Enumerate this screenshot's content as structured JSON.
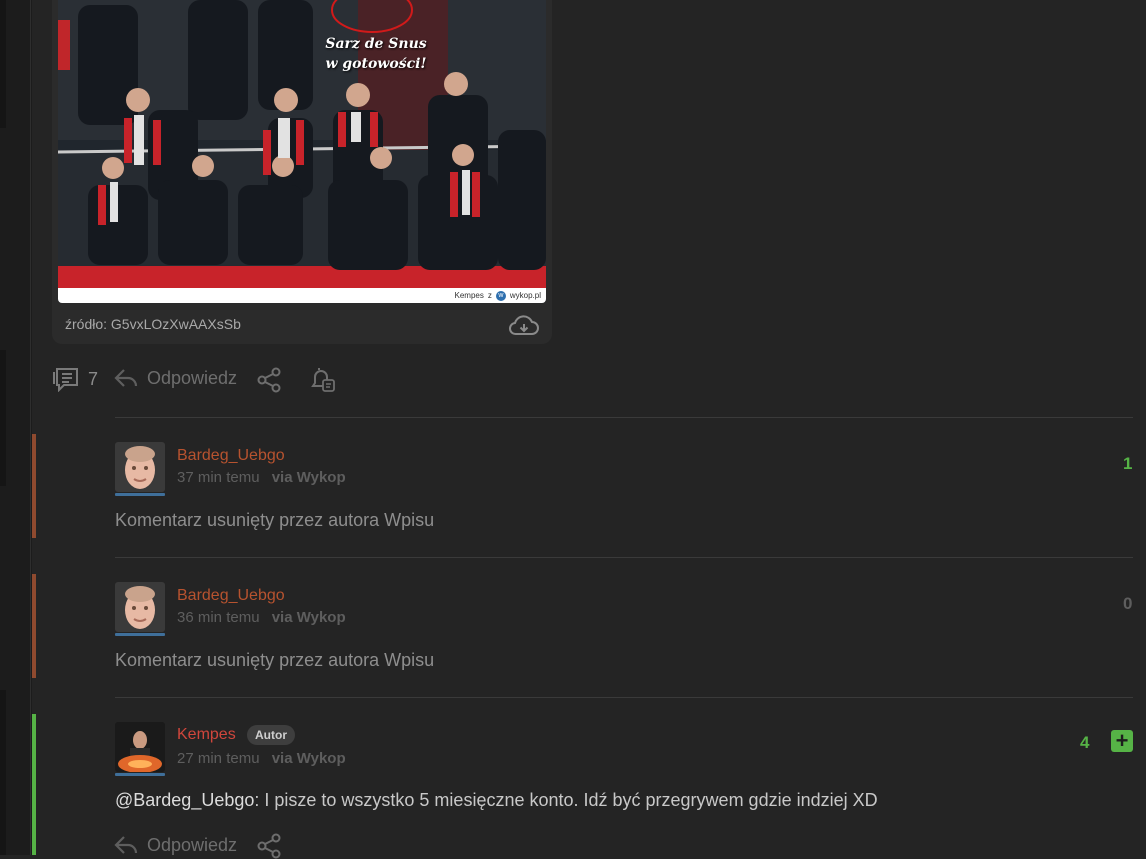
{
  "post": {
    "image_overlay_line1": "Sarz de Snus",
    "image_overlay_line2": "w gotowości!",
    "image_credit_author": "Kempes",
    "image_credit_sep": "z",
    "image_credit_site": "wykop.pl",
    "source_label": "źródło:",
    "source_value": "G5vxLOzXwAAXsSb",
    "comment_count": "7",
    "reply_label": "Odpowiedz"
  },
  "comments": [
    {
      "username": "Bardeg_Uebgo",
      "time": "37 min temu",
      "via": "via Wykop",
      "text": "Komentarz usunięty przez autora Wpisu",
      "score": "1",
      "username_color": "#b7532f",
      "bar_color": "#8f4a2f",
      "score_color": "#56b346"
    },
    {
      "username": "Bardeg_Uebgo",
      "time": "36 min temu",
      "via": "via Wykop",
      "text": "Komentarz usunięty przez autora Wpisu",
      "score": "0",
      "username_color": "#b7532f",
      "bar_color": "#8f4a2f",
      "score_color": "#5e5e5e"
    },
    {
      "username": "Kempes",
      "badge": "Autor",
      "time": "27 min temu",
      "via": "via Wykop",
      "mention": "@Bardeg_Uebgo",
      "text": ": I pisze to wszystko 5 miesięczne konto. Idź być przegrywem gdzie indziej XD",
      "score": "4",
      "plus": "+",
      "reply_label": "Odpowiedz",
      "username_color": "#d0463c",
      "bar_color": "#56b346",
      "score_color": "#56b346"
    }
  ],
  "colors": {
    "background": "#242424",
    "card": "#2b2b2b",
    "muted_text": "#6e6e6e",
    "accent_green": "#56b346",
    "deleted_user": "#b7532f",
    "author_red": "#d0463c"
  },
  "icons": {
    "comments": "comments-icon",
    "reply": "reply-arrow-icon",
    "share": "share-icon",
    "notify": "bell-icon",
    "download": "cloud-download-icon",
    "plus": "plus-icon"
  }
}
